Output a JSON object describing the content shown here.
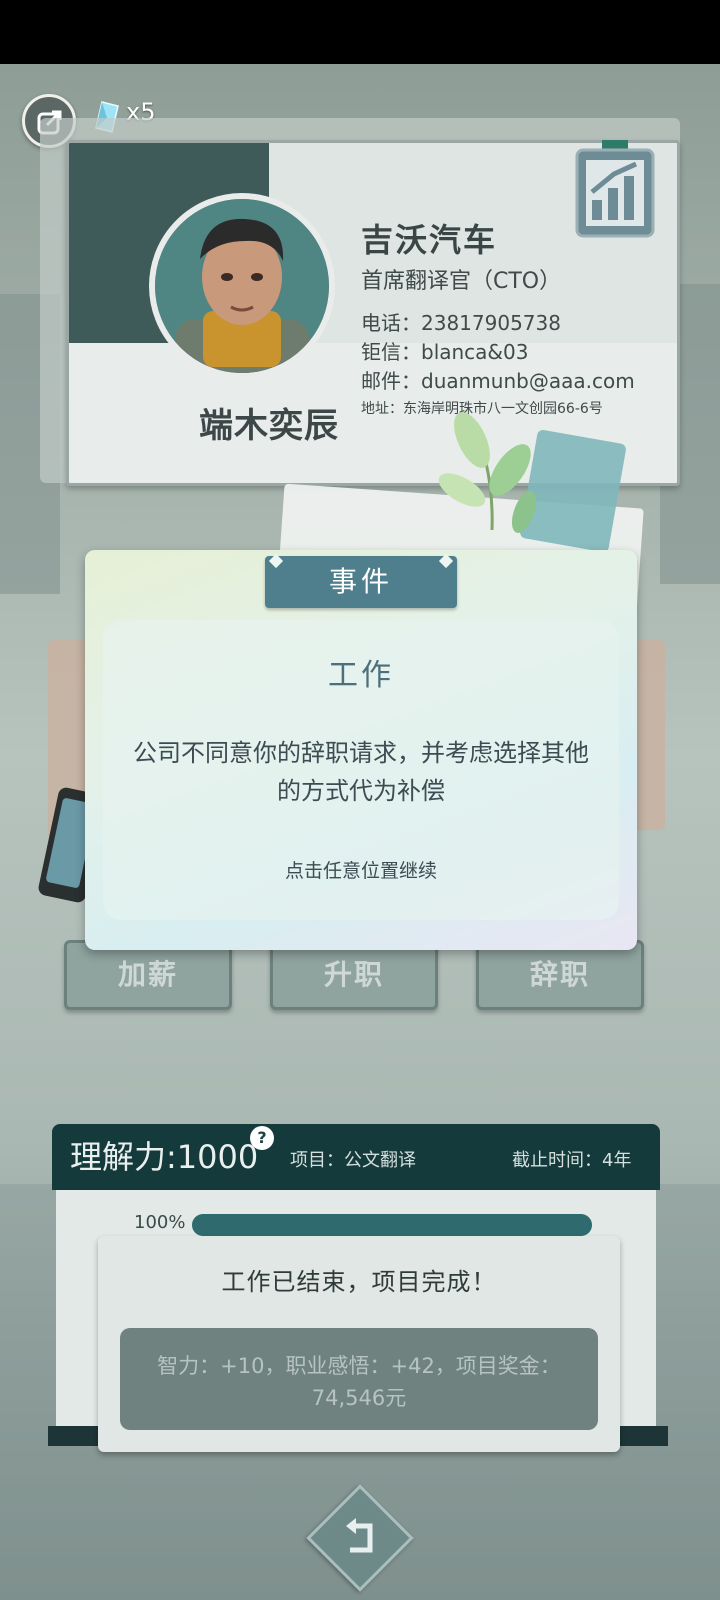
{
  "hud": {
    "gem_count": "x5"
  },
  "business_card": {
    "name": "端木奕辰",
    "company": "吉沃汽车",
    "title": "首席翻译官（CTO）",
    "phone": "电话：23817905738",
    "chat": "钜信：blanca&03",
    "email": "邮件：duanmunb@aaa.com",
    "address": "地址：东海岸明珠市八一文创园66-6号"
  },
  "actions": [
    {
      "label": "加薪"
    },
    {
      "label": "升职"
    },
    {
      "label": "辞职"
    }
  ],
  "event_modal": {
    "header": "事件",
    "title": "工作",
    "body": "公司不同意你的辞职请求，并考虑选择其他的方式代为补偿",
    "continue_hint": "点击任意位置继续"
  },
  "project": {
    "skill": "理解力:1000",
    "help": "?",
    "name": "项目：公文翻译",
    "deadline": "截止时间：4年",
    "progress_label": "100%",
    "progress": 1.0
  },
  "completion_popup": {
    "title": "工作已结束，项目完成！",
    "rewards": "智力：+10，职业感悟：+42，项目奖金：74,546元"
  },
  "colors": {
    "accent": "#4f7f8c",
    "panel_dark": "#153a3c",
    "progress": "#2f6b6e"
  }
}
